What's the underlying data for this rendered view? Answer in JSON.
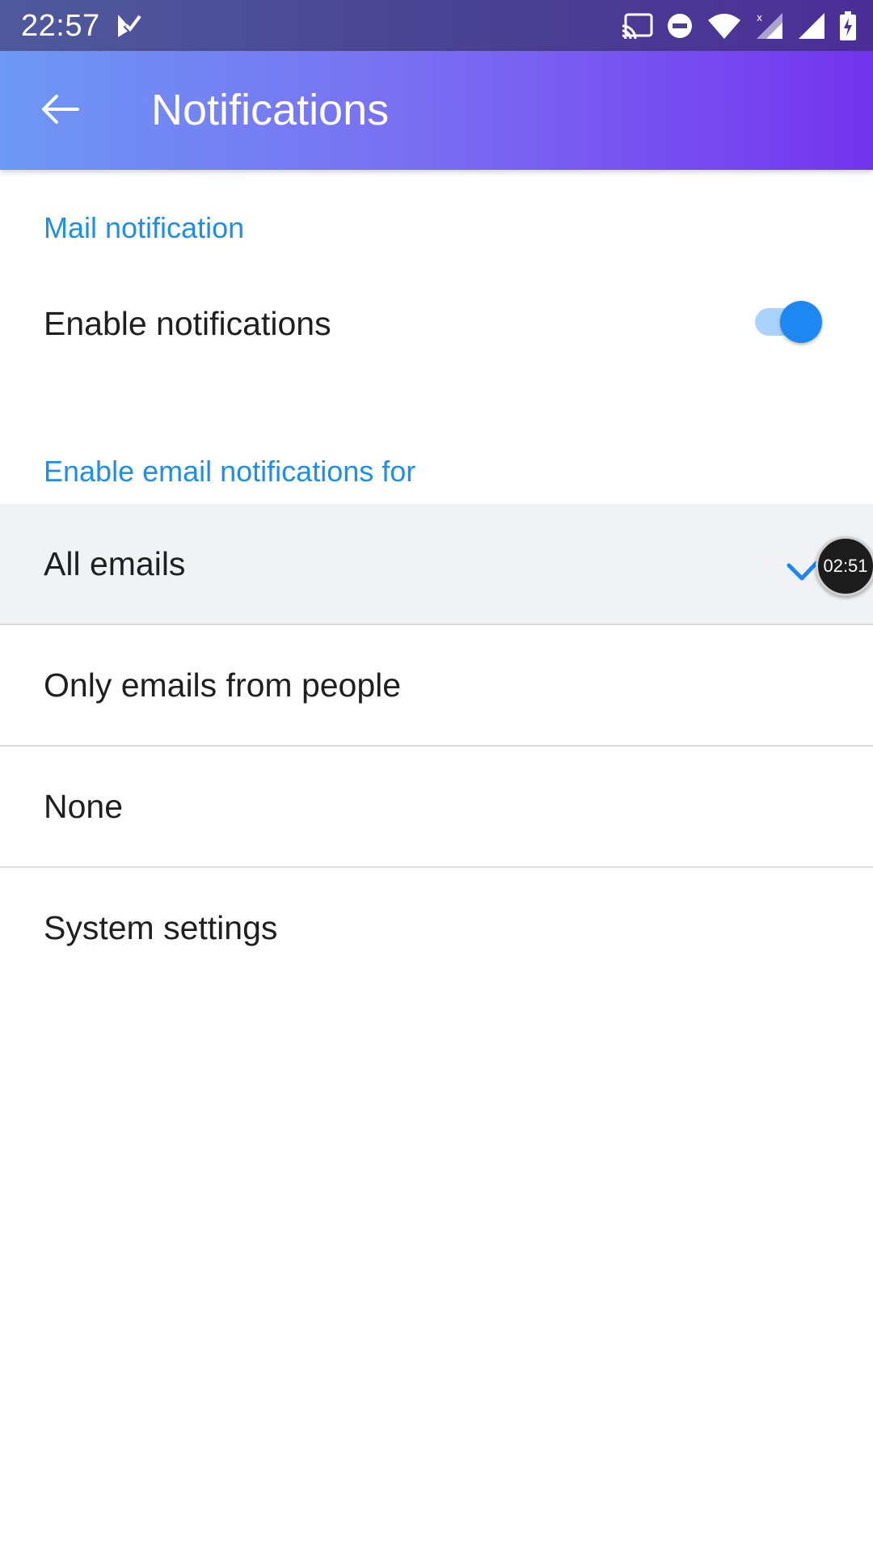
{
  "status_bar": {
    "time": "22:57",
    "icons": [
      "app-check-icon",
      "cast-icon",
      "do-not-disturb-icon",
      "wifi-icon",
      "signal-x-icon",
      "signal-icon",
      "battery-charging-icon"
    ]
  },
  "app_bar": {
    "title": "Notifications",
    "back_icon": "arrow-left-icon"
  },
  "mail_notification": {
    "header": "Mail notification",
    "enable_label": "Enable notifications",
    "enabled": true
  },
  "email_filter": {
    "header": "Enable email notifications for",
    "options": [
      {
        "label": "All emails",
        "selected": true
      },
      {
        "label": "Only emails from people",
        "selected": false
      },
      {
        "label": "None",
        "selected": false
      }
    ]
  },
  "system_settings": {
    "label": "System settings"
  },
  "overlay": {
    "timer": "02:51"
  },
  "colors": {
    "accent": "#1e88f2",
    "header_text": "#1d8fe8",
    "app_bar_start": "#6d98f4",
    "app_bar_end": "#7334ee"
  }
}
